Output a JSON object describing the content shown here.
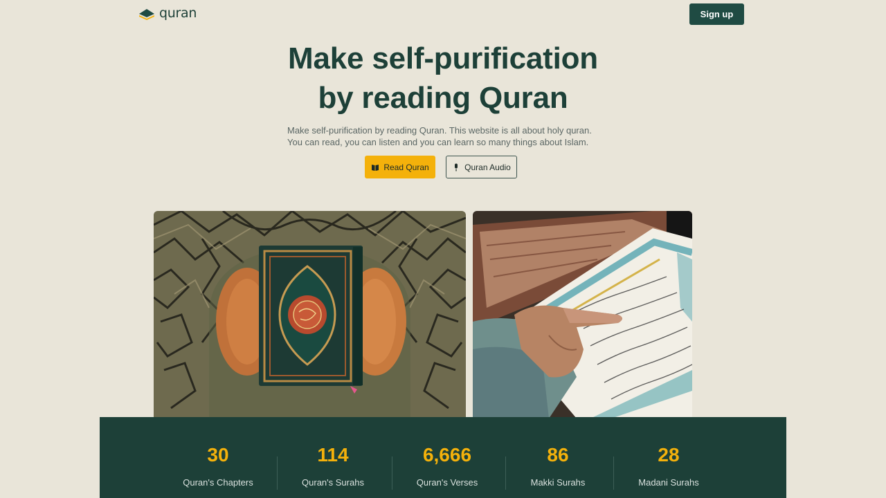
{
  "header": {
    "logo_text": "quran",
    "signup_label": "Sign up"
  },
  "hero": {
    "title_line1": "Make self-purification",
    "title_line2": "by reading Quran",
    "description": "Make self-purification by reading Quran. This website is all about holy quran. You can read, you can listen and you can learn so many things about Islam.",
    "read_button": {
      "label": "Read Quran",
      "icon": "book-icon"
    },
    "audio_button": {
      "label": "Quran Audio",
      "icon": "microphone-icon"
    }
  },
  "images": [
    {
      "name": "quran-book-photo"
    },
    {
      "name": "reading-quran-photo"
    }
  ],
  "stats": [
    {
      "value": "30",
      "label": "Quran's Chapters"
    },
    {
      "value": "114",
      "label": "Quran's Surahs"
    },
    {
      "value": "6,666",
      "label": "Quran's Verses"
    },
    {
      "value": "86",
      "label": "Makki Surahs"
    },
    {
      "value": "28",
      "label": "Madani Surahs"
    }
  ],
  "colors": {
    "background": "#e9e5d9",
    "primary": "#1d4038",
    "accent": "#f4b10b"
  }
}
